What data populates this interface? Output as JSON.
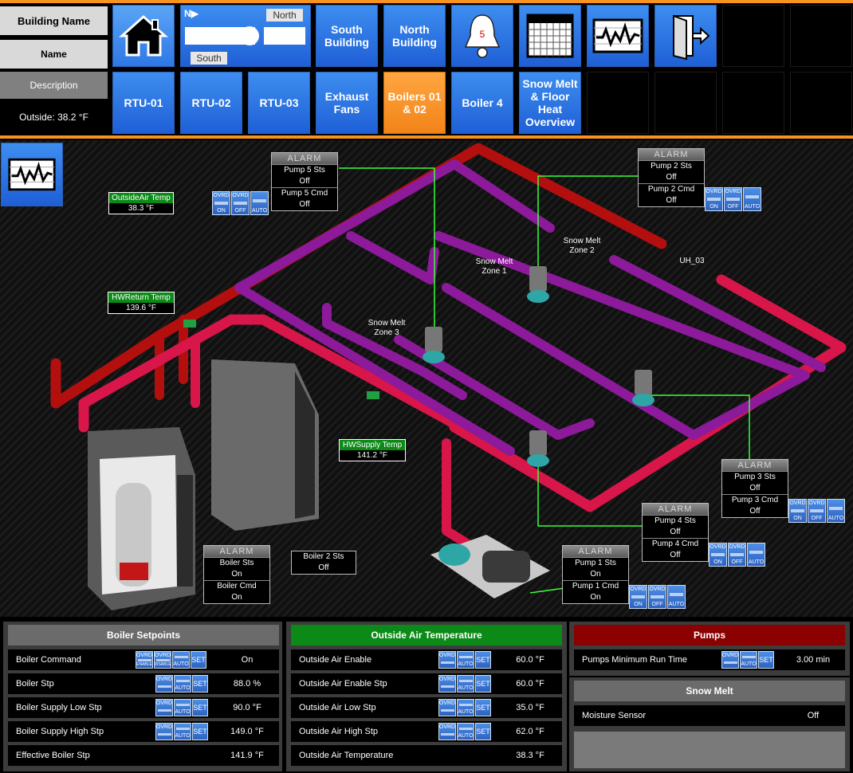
{
  "header": {
    "building_name": "Building Name",
    "name": "Name",
    "description": "Description",
    "outside": "Outside: 38.2 °F"
  },
  "nav_row1": {
    "map_north": "North",
    "map_south": "South",
    "map_compass": "N▶",
    "south_building": "South Building",
    "north_building": "North Building",
    "alarm_count": "5"
  },
  "nav_row2": {
    "rtu01": "RTU-01",
    "rtu02": "RTU-02",
    "rtu03": "RTU-03",
    "exhaust": "Exhaust Fans",
    "boilers": "Boilers 01 & 02",
    "boiler4": "Boiler 4",
    "snowmelt": "Snow Melt & Floor Heat Overview"
  },
  "diagram": {
    "oa_temp": {
      "label": "OutsideAir Temp",
      "value": "38.3 °F"
    },
    "hwr_temp": {
      "label": "HWReturn Temp",
      "value": "139.6 °F"
    },
    "hws_temp": {
      "label": "HWSupply Temp",
      "value": "141.2 °F"
    },
    "zone1": "Snow Melt Zone 1",
    "zone2": "Snow Melt Zone 2",
    "zone3": "Snow Melt Zone 3",
    "uh03": "UH_03",
    "alarm": "ALARM",
    "pump5": {
      "sts_label": "Pump 5 Sts",
      "sts": "Off",
      "cmd_label": "Pump 5 Cmd",
      "cmd": "Off"
    },
    "pump2": {
      "sts_label": "Pump 2 Sts",
      "sts": "Off",
      "cmd_label": "Pump 2 Cmd",
      "cmd": "Off"
    },
    "pump3": {
      "sts_label": "Pump 3 Sts",
      "sts": "Off",
      "cmd_label": "Pump 3 Cmd",
      "cmd": "Off"
    },
    "pump4": {
      "sts_label": "Pump 4 Sts",
      "sts": "Off",
      "cmd_label": "Pump 4 Cmd",
      "cmd": "Off"
    },
    "pump1": {
      "sts_label": "Pump 1 Sts",
      "sts": "On",
      "cmd_label": "Pump 1 Cmd",
      "cmd": "On"
    },
    "boiler": {
      "sts_label": "Boiler Sts",
      "sts": "On",
      "cmd_label": "Boiler Cmd",
      "cmd": "On"
    },
    "boiler2": {
      "sts_label": "Boiler 2 Sts",
      "sts": "Off"
    },
    "ovrd": "OVRD",
    "on": "ON",
    "off": "OFF",
    "auto": "AUTO",
    "enable": "ENABLE",
    "disable": "DISABLE",
    "set": "SET"
  },
  "boiler_setpoints": {
    "title": "Boiler Setpoints",
    "color": "#6b6b6b",
    "rows": [
      {
        "label": "Boiler Command",
        "value": "On"
      },
      {
        "label": "Boiler Stp",
        "value": "88.0 %"
      },
      {
        "label": "Boiler Supply Low Stp",
        "value": "90.0 °F"
      },
      {
        "label": "Boiler Supply High Stp",
        "value": "149.0 °F"
      },
      {
        "label": "Effective Boiler Stp",
        "value": "141.9 °F"
      }
    ]
  },
  "oat": {
    "title": "Outside Air Temperature",
    "color": "#0b8a17",
    "rows": [
      {
        "label": "Outside Air Enable",
        "value": "60.0 °F"
      },
      {
        "label": "Outside Air Enable Stp",
        "value": "60.0 °F"
      },
      {
        "label": "Outside Air Low Stp",
        "value": "35.0 °F"
      },
      {
        "label": "Outside Air High Stp",
        "value": "62.0 °F"
      },
      {
        "label": "Outside Air Temperature",
        "value": "38.3 °F"
      }
    ]
  },
  "pumps": {
    "title": "Pumps",
    "color": "#8b0000",
    "rows": [
      {
        "label": "Pumps Minimum Run Time",
        "value": "3.00 min"
      }
    ]
  },
  "snow": {
    "title": "Snow Melt",
    "rows": [
      {
        "label": "Moisture Sensor",
        "value": "Off"
      }
    ]
  }
}
